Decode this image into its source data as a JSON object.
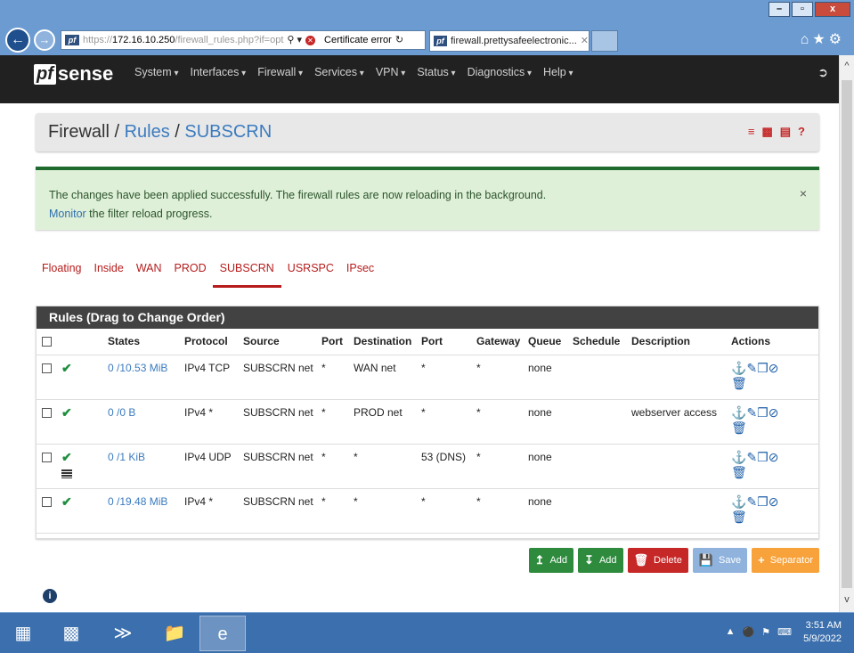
{
  "browser": {
    "url_prefix": "https://",
    "url_host": "172.16.10.250",
    "url_path": "/firewall_rules.php?if=opt",
    "cert_error": "Certificate error",
    "tab_title": "firewall.prettysafeelectronic...",
    "favicon_text": "pf"
  },
  "navbar": {
    "logo_pf": "pf",
    "logo_text": "sense",
    "menu": [
      "System",
      "Interfaces",
      "Firewall",
      "Services",
      "VPN",
      "Status",
      "Diagnostics",
      "Help"
    ]
  },
  "breadcrumb": {
    "part1": "Firewall",
    "sep1": " / ",
    "part2": "Rules",
    "sep2": " / ",
    "part3": "SUBSCRN"
  },
  "alert": {
    "line1": "The changes have been applied successfully. The firewall rules are now reloading in the background.",
    "link": "Monitor",
    "line2_rest": " the filter reload progress.",
    "close": "×"
  },
  "tabs": [
    "Floating",
    "Inside",
    "WAN",
    "PROD",
    "SUBSCRN",
    "USRSPC",
    "IPsec"
  ],
  "active_tab": "SUBSCRN",
  "panel": {
    "title": "Rules (Drag to Change Order)",
    "headers": {
      "states": "States",
      "protocol": "Protocol",
      "source": "Source",
      "port": "Port",
      "destination": "Destination",
      "dport": "Port",
      "gateway": "Gateway",
      "queue": "Queue",
      "schedule": "Schedule",
      "description": "Description",
      "actions": "Actions"
    },
    "rows": [
      {
        "states": "0 /10.53 MiB",
        "protocol": "IPv4 TCP",
        "source": "SUBSCRN net",
        "port": "*",
        "destination": "WAN net",
        "dport": "*",
        "gateway": "*",
        "queue": "none",
        "schedule": "",
        "description": ""
      },
      {
        "states": "0 /0 B",
        "protocol": "IPv4 *",
        "source": "SUBSCRN net",
        "port": "*",
        "destination": "PROD net",
        "dport": "*",
        "gateway": "*",
        "queue": "none",
        "schedule": "",
        "description": "webserver access"
      },
      {
        "states": "0 /1 KiB",
        "protocol": "IPv4 UDP",
        "source": "SUBSCRN net",
        "port": "*",
        "destination": "*",
        "dport": "53 (DNS)",
        "gateway": "*",
        "queue": "none",
        "schedule": "",
        "description": ""
      },
      {
        "states": "0 /19.48 MiB",
        "protocol": "IPv4 *",
        "source": "SUBSCRN net",
        "port": "*",
        "destination": "*",
        "dport": "*",
        "gateway": "*",
        "queue": "none",
        "schedule": "",
        "description": ""
      }
    ]
  },
  "buttons": {
    "add_top": "Add",
    "add_bottom": "Add",
    "delete": "Delete",
    "save": "Save",
    "separator": "Separator"
  },
  "taskbar": {
    "time": "3:51 AM",
    "date": "5/9/2022"
  },
  "colors": {
    "accent_red": "#b71c1c",
    "link_blue": "#3b7bbf",
    "navbar": "#212121",
    "success_bg": "#dff0d8",
    "add_green": "#2e8b3e",
    "separator_orange": "#f7a23b"
  }
}
